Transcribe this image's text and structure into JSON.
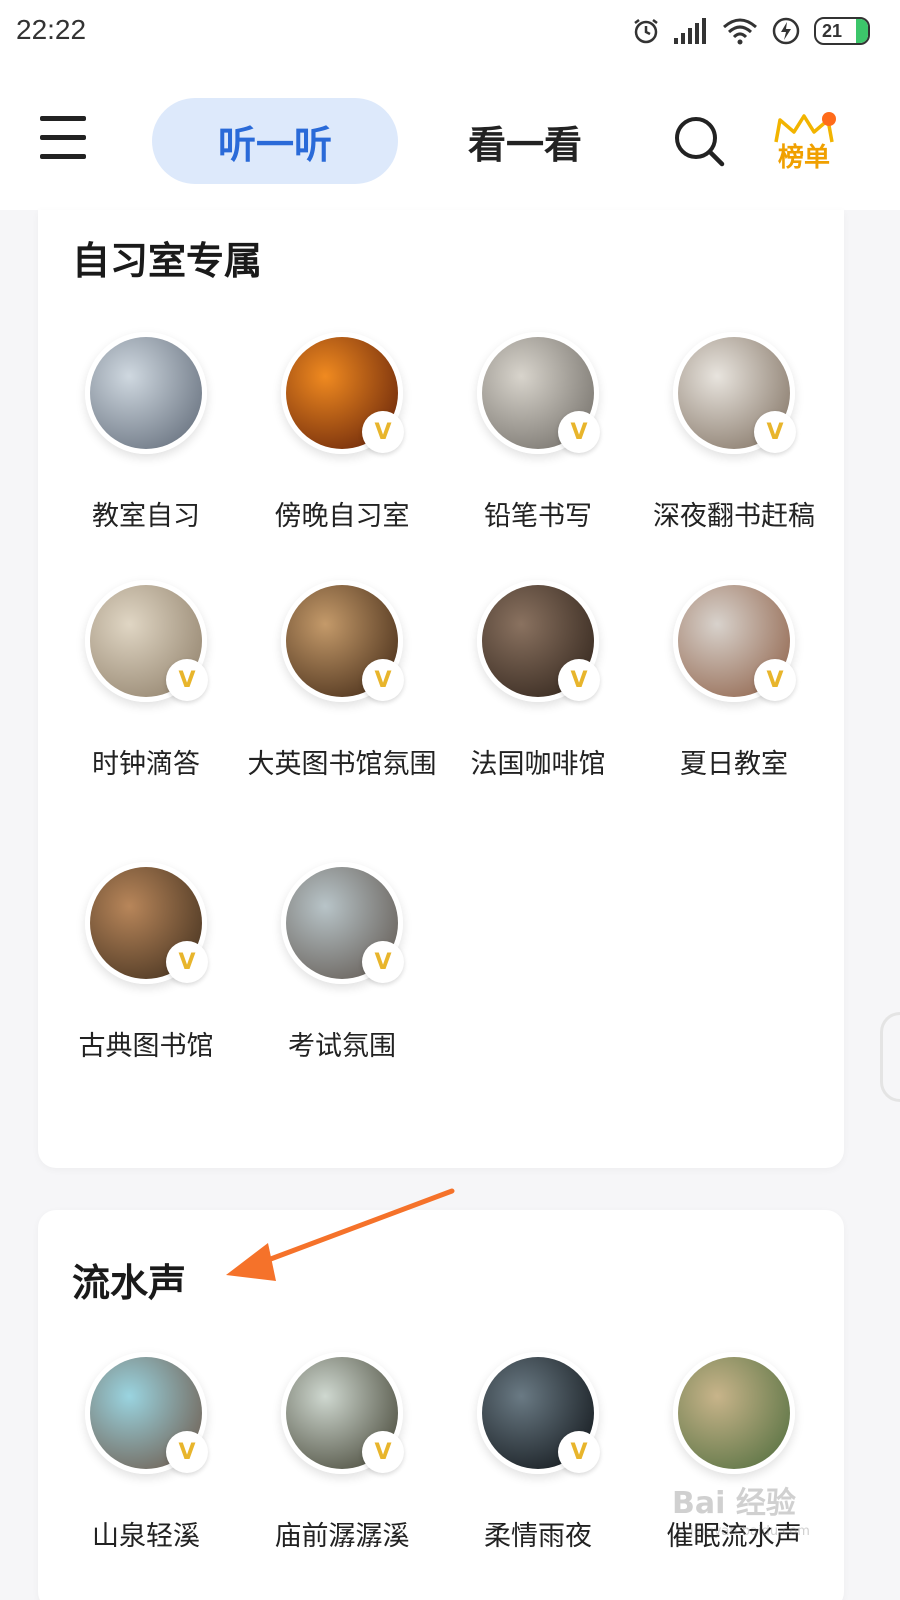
{
  "status": {
    "time": "22:22",
    "battery": "21",
    "icons": [
      "alarm-icon",
      "signal-icon",
      "wifi-icon",
      "charging-icon",
      "battery-icon"
    ]
  },
  "nav": {
    "menu_icon": "hamburger-menu-icon",
    "tabs": [
      {
        "label": "听一听",
        "active": true
      },
      {
        "label": "看一看",
        "active": false
      }
    ],
    "search_icon": "search-icon",
    "rank_label": "榜单"
  },
  "sections": [
    {
      "title": "自习室专属",
      "items": [
        {
          "label": "教室自习",
          "vip": false,
          "colors": [
            "#cfd8e0",
            "#5a6472"
          ]
        },
        {
          "label": "傍晚自习室",
          "vip": true,
          "colors": [
            "#f08a20",
            "#5a1a08"
          ]
        },
        {
          "label": "铅笔书写",
          "vip": true,
          "colors": [
            "#d8d4cc",
            "#6a6660"
          ]
        },
        {
          "label": "深夜翻书赶稿",
          "vip": true,
          "colors": [
            "#e8e4de",
            "#7a6a5a"
          ]
        },
        {
          "label": "时钟滴答",
          "vip": true,
          "colors": [
            "#e0d6c4",
            "#8a7a64"
          ]
        },
        {
          "label": "大英图书馆氛围",
          "vip": true,
          "colors": [
            "#c49a6a",
            "#3a2210"
          ]
        },
        {
          "label": "法国咖啡馆",
          "vip": true,
          "colors": [
            "#8a7260",
            "#2a1e16"
          ]
        },
        {
          "label": "夏日教室",
          "vip": true,
          "colors": [
            "#d8d2cc",
            "#8a5a40"
          ]
        },
        {
          "label": "古典图书馆",
          "vip": true,
          "colors": [
            "#b8865a",
            "#3a2a1a"
          ]
        },
        {
          "label": "考试氛围",
          "vip": true,
          "colors": [
            "#b8c4c8",
            "#5a5048"
          ]
        }
      ]
    },
    {
      "title": "流水声",
      "items": [
        {
          "label": "山泉轻溪",
          "vip": true,
          "colors": [
            "#9ad4e0",
            "#6a5040"
          ]
        },
        {
          "label": "庙前潺潺溪",
          "vip": true,
          "colors": [
            "#cfd8d0",
            "#3a3a2a"
          ]
        },
        {
          "label": "柔情雨夜",
          "vip": true,
          "colors": [
            "#6a7a84",
            "#0a0e12"
          ]
        },
        {
          "label": "催眠流水声",
          "vip": false,
          "colors": [
            "#c8b48a",
            "#4a6a3a"
          ]
        }
      ]
    }
  ],
  "vip_mark": "V",
  "watermark": "Bai 经验",
  "watermark_sub": "jingyan.baidu.com"
}
